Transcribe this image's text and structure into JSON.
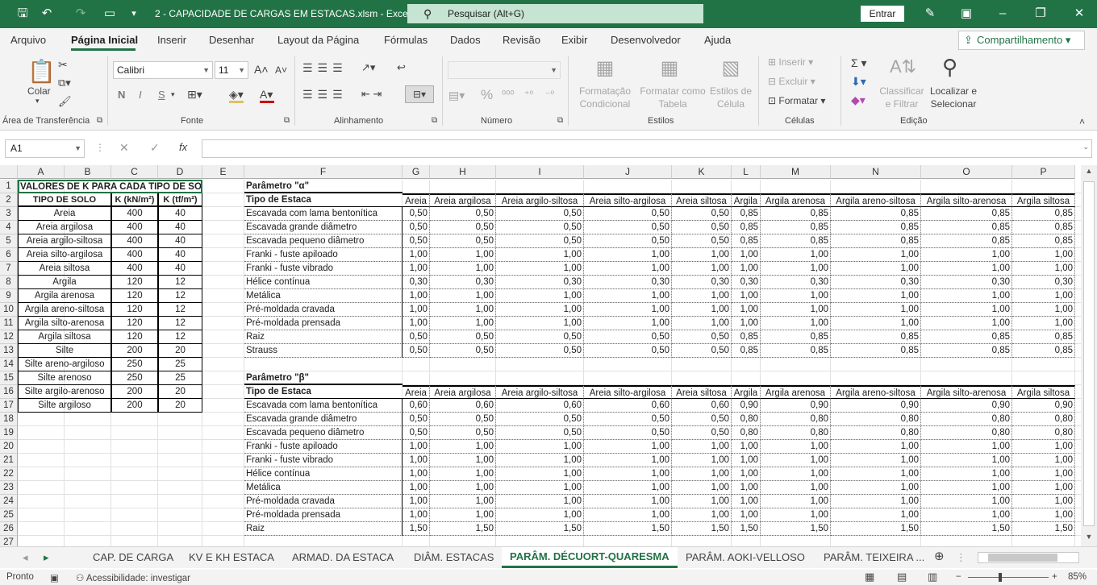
{
  "titlebar": {
    "title": "2 - CAPACIDADE DE CARGAS EM ESTACAS.xlsm  -  Excel",
    "search": "Pesquisar (Alt+G)",
    "signin": "Entrar"
  },
  "tabs": [
    "Arquivo",
    "Página Inicial",
    "Inserir",
    "Desenhar",
    "Layout da Página",
    "Fórmulas",
    "Dados",
    "Revisão",
    "Exibir",
    "Desenvolvedor",
    "Ajuda"
  ],
  "share": "Compartilhamento",
  "ribbon": {
    "paste": "Colar",
    "font": "Calibri",
    "size": "11",
    "bold": "N",
    "italic": "I",
    "underline": "S",
    "g_clip": "Área de Transferência",
    "g_font": "Fonte",
    "g_align": "Alinhamento",
    "g_num": "Número",
    "g_styles": "Estilos",
    "g_cells": "Células",
    "g_edit": "Edição",
    "cond1": "Formatação",
    "cond2": "Condicional",
    "fmt1": "Formatar como",
    "fmt2": "Tabela",
    "sty1": "Estilos de",
    "sty2": "Célula",
    "insert": "Inserir",
    "delete": "Excluir",
    "format": "Formatar",
    "sort1": "Classificar",
    "sort2": "e Filtrar",
    "find1": "Localizar e",
    "find2": "Selecionar",
    "pct": "%"
  },
  "namebox": "A1",
  "columns": [
    "A",
    "B",
    "C",
    "D",
    "E",
    "F",
    "G",
    "H",
    "I",
    "J",
    "K",
    "L",
    "M",
    "N",
    "O",
    "P"
  ],
  "rows": [
    "1",
    "2",
    "3",
    "4",
    "5",
    "6",
    "7",
    "8",
    "9",
    "10",
    "11",
    "12",
    "13",
    "14",
    "15",
    "16",
    "17",
    "18",
    "19",
    "20",
    "21",
    "22",
    "23",
    "24",
    "25",
    "26",
    "27"
  ],
  "k_table": {
    "title": "VALORES DE K PARA CADA TIPO DE SOLO",
    "headers": [
      "TIPO DE SOLO",
      "K (kN/m²)",
      "K (tf/m²)"
    ],
    "rows": [
      [
        "Areia",
        "400",
        "40"
      ],
      [
        "Areia argilosa",
        "400",
        "40"
      ],
      [
        "Areia argilo-siltosa",
        "400",
        "40"
      ],
      [
        "Areia silto-argilosa",
        "400",
        "40"
      ],
      [
        "Areia siltosa",
        "400",
        "40"
      ],
      [
        "Argila",
        "120",
        "12"
      ],
      [
        "Argila arenosa",
        "120",
        "12"
      ],
      [
        "Argila areno-siltosa",
        "120",
        "12"
      ],
      [
        "Argila silto-arenosa",
        "120",
        "12"
      ],
      [
        "Argila siltosa",
        "120",
        "12"
      ],
      [
        "Silte",
        "200",
        "20"
      ],
      [
        "Silte areno-argiloso",
        "250",
        "25"
      ],
      [
        "Silte arenoso",
        "250",
        "25"
      ],
      [
        "Silte argilo-arenoso",
        "200",
        "20"
      ],
      [
        "Silte argiloso",
        "200",
        "20"
      ]
    ]
  },
  "alpha": {
    "title": "Parâmetro \"α\"",
    "header": "Tipo de Estaca",
    "soils": [
      "Areia",
      "Areia argilosa",
      "Areia argilo-siltosa",
      "Areia silto-argilosa",
      "Areia siltosa",
      "Argila",
      "Argila arenosa",
      "Argila areno-siltosa",
      "Argila silto-arenosa",
      "Argila siltosa"
    ],
    "rows": [
      {
        "n": "Escavada com lama bentonítica",
        "v": [
          "0,50",
          "0,50",
          "0,50",
          "0,50",
          "0,50",
          "0,85",
          "0,85",
          "0,85",
          "0,85",
          "0,85"
        ]
      },
      {
        "n": "Escavada grande diâmetro",
        "v": [
          "0,50",
          "0,50",
          "0,50",
          "0,50",
          "0,50",
          "0,85",
          "0,85",
          "0,85",
          "0,85",
          "0,85"
        ]
      },
      {
        "n": "Escavada pequeno diâmetro",
        "v": [
          "0,50",
          "0,50",
          "0,50",
          "0,50",
          "0,50",
          "0,85",
          "0,85",
          "0,85",
          "0,85",
          "0,85"
        ]
      },
      {
        "n": "Franki - fuste apiloado",
        "v": [
          "1,00",
          "1,00",
          "1,00",
          "1,00",
          "1,00",
          "1,00",
          "1,00",
          "1,00",
          "1,00",
          "1,00"
        ]
      },
      {
        "n": "Franki - fuste vibrado",
        "v": [
          "1,00",
          "1,00",
          "1,00",
          "1,00",
          "1,00",
          "1,00",
          "1,00",
          "1,00",
          "1,00",
          "1,00"
        ]
      },
      {
        "n": "Hélice contínua",
        "v": [
          "0,30",
          "0,30",
          "0,30",
          "0,30",
          "0,30",
          "0,30",
          "0,30",
          "0,30",
          "0,30",
          "0,30"
        ]
      },
      {
        "n": "Metálica",
        "v": [
          "1,00",
          "1,00",
          "1,00",
          "1,00",
          "1,00",
          "1,00",
          "1,00",
          "1,00",
          "1,00",
          "1,00"
        ]
      },
      {
        "n": "Pré-moldada cravada",
        "v": [
          "1,00",
          "1,00",
          "1,00",
          "1,00",
          "1,00",
          "1,00",
          "1,00",
          "1,00",
          "1,00",
          "1,00"
        ]
      },
      {
        "n": "Pré-moldada prensada",
        "v": [
          "1,00",
          "1,00",
          "1,00",
          "1,00",
          "1,00",
          "1,00",
          "1,00",
          "1,00",
          "1,00",
          "1,00"
        ]
      },
      {
        "n": "Raiz",
        "v": [
          "0,50",
          "0,50",
          "0,50",
          "0,50",
          "0,50",
          "0,85",
          "0,85",
          "0,85",
          "0,85",
          "0,85"
        ]
      },
      {
        "n": "Strauss",
        "v": [
          "0,50",
          "0,50",
          "0,50",
          "0,50",
          "0,50",
          "0,85",
          "0,85",
          "0,85",
          "0,85",
          "0,85"
        ]
      }
    ]
  },
  "beta": {
    "title": "Parâmetro \"β\"",
    "header": "Tipo de Estaca",
    "rows": [
      {
        "n": "Escavada com lama bentonítica",
        "v": [
          "0,60",
          "0,60",
          "0,60",
          "0,60",
          "0,60",
          "0,90",
          "0,90",
          "0,90",
          "0,90",
          "0,90"
        ]
      },
      {
        "n": "Escavada grande diâmetro",
        "v": [
          "0,50",
          "0,50",
          "0,50",
          "0,50",
          "0,50",
          "0,80",
          "0,80",
          "0,80",
          "0,80",
          "0,80"
        ]
      },
      {
        "n": "Escavada pequeno diâmetro",
        "v": [
          "0,50",
          "0,50",
          "0,50",
          "0,50",
          "0,50",
          "0,80",
          "0,80",
          "0,80",
          "0,80",
          "0,80"
        ]
      },
      {
        "n": "Franki - fuste apiloado",
        "v": [
          "1,00",
          "1,00",
          "1,00",
          "1,00",
          "1,00",
          "1,00",
          "1,00",
          "1,00",
          "1,00",
          "1,00"
        ]
      },
      {
        "n": "Franki - fuste vibrado",
        "v": [
          "1,00",
          "1,00",
          "1,00",
          "1,00",
          "1,00",
          "1,00",
          "1,00",
          "1,00",
          "1,00",
          "1,00"
        ]
      },
      {
        "n": "Hélice contínua",
        "v": [
          "1,00",
          "1,00",
          "1,00",
          "1,00",
          "1,00",
          "1,00",
          "1,00",
          "1,00",
          "1,00",
          "1,00"
        ]
      },
      {
        "n": "Metálica",
        "v": [
          "1,00",
          "1,00",
          "1,00",
          "1,00",
          "1,00",
          "1,00",
          "1,00",
          "1,00",
          "1,00",
          "1,00"
        ]
      },
      {
        "n": "Pré-moldada cravada",
        "v": [
          "1,00",
          "1,00",
          "1,00",
          "1,00",
          "1,00",
          "1,00",
          "1,00",
          "1,00",
          "1,00",
          "1,00"
        ]
      },
      {
        "n": "Pré-moldada prensada",
        "v": [
          "1,00",
          "1,00",
          "1,00",
          "1,00",
          "1,00",
          "1,00",
          "1,00",
          "1,00",
          "1,00",
          "1,00"
        ]
      },
      {
        "n": "Raiz",
        "v": [
          "1,50",
          "1,50",
          "1,50",
          "1,50",
          "1,50",
          "1,50",
          "1,50",
          "1,50",
          "1,50",
          "1,50"
        ]
      }
    ]
  },
  "sheets": [
    "CAP. DE CARGA",
    "KV E KH ESTACA",
    "ARMAD. DA ESTACA",
    "DIÂM. ESTACAS",
    "PARÂM. DÉCUORT-QUARESMA",
    "PARÂM. AOKI-VELLOSO",
    "PARÂM. TEIXEIRA ..."
  ],
  "status": {
    "ready": "Pronto",
    "access": "Acessibilidade: investigar",
    "zoom": "85%"
  }
}
